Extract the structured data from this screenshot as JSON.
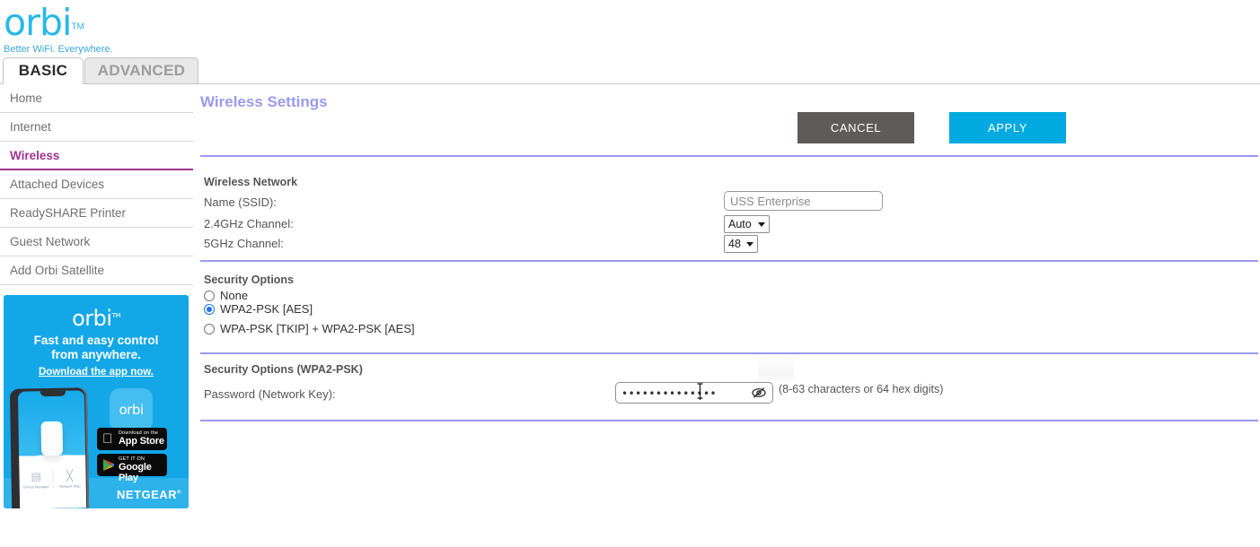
{
  "brand": {
    "logo_text": "orbi",
    "logo_tm": "TM",
    "tagline": "Better WiFi. Everywhere.",
    "accent_cyan": "#2ab8e6",
    "accent_purple": "#9a9aee",
    "accent_magenta": "#a0338f"
  },
  "tabs": [
    {
      "label": "BASIC",
      "active": true
    },
    {
      "label": "ADVANCED",
      "active": false
    }
  ],
  "sidebar": {
    "items": [
      {
        "label": "Home",
        "active": false
      },
      {
        "label": "Internet",
        "active": false
      },
      {
        "label": "Wireless",
        "active": true
      },
      {
        "label": "Attached Devices",
        "active": false
      },
      {
        "label": "ReadySHARE Printer",
        "active": false
      },
      {
        "label": "Guest Network",
        "active": false
      },
      {
        "label": "Add Orbi Satellite",
        "active": false
      }
    ]
  },
  "promo": {
    "logo": "orbi",
    "logo_tm": "TM",
    "line1": "Fast and easy control",
    "line2": "from anywhere.",
    "link": "Download the app now.",
    "app_icon_label": "orbi",
    "app_icon_brand": "NETGEAR",
    "apple_small": "Download on the",
    "apple_large": "App Store",
    "apple_icon": "apple-icon",
    "google_small": "GET IT ON",
    "google_large": "Google Play",
    "google_icon": "google-play-icon",
    "netgear": "NETGEAR",
    "netgear_tm": "®",
    "phone_tile_left": "Device Manager",
    "phone_tile_right": "Network Map",
    "background": "#13a7e8"
  },
  "main": {
    "page_title": "Wireless Settings",
    "buttons": {
      "cancel": "CANCEL",
      "apply": "APPLY",
      "cancel_color": "#5e5b5a",
      "apply_color": "#00a9e0"
    },
    "wireless_network": {
      "heading": "Wireless Network",
      "ssid_label": "Name (SSID):",
      "ssid_value": "USS Enterprise",
      "channel_24_label": "2.4GHz Channel:",
      "channel_24_value": "Auto",
      "channel_5_label": "5GHz Channel:",
      "channel_5_value": "48"
    },
    "security_options": {
      "heading": "Security Options",
      "options": [
        {
          "label": "None",
          "selected": false
        },
        {
          "label": "WPA2-PSK [AES]",
          "selected": true
        },
        {
          "label": "WPA-PSK [TKIP] + WPA2-PSK [AES]",
          "selected": false
        }
      ]
    },
    "wpa_section": {
      "heading": "Security Options (WPA2-PSK)",
      "password_label": "Password (Network Key):",
      "password_masked": "••••••••••••••",
      "password_hint": "(8-63 characters or 64 hex digits)",
      "reveal_icon": "eye-slash-icon"
    }
  }
}
